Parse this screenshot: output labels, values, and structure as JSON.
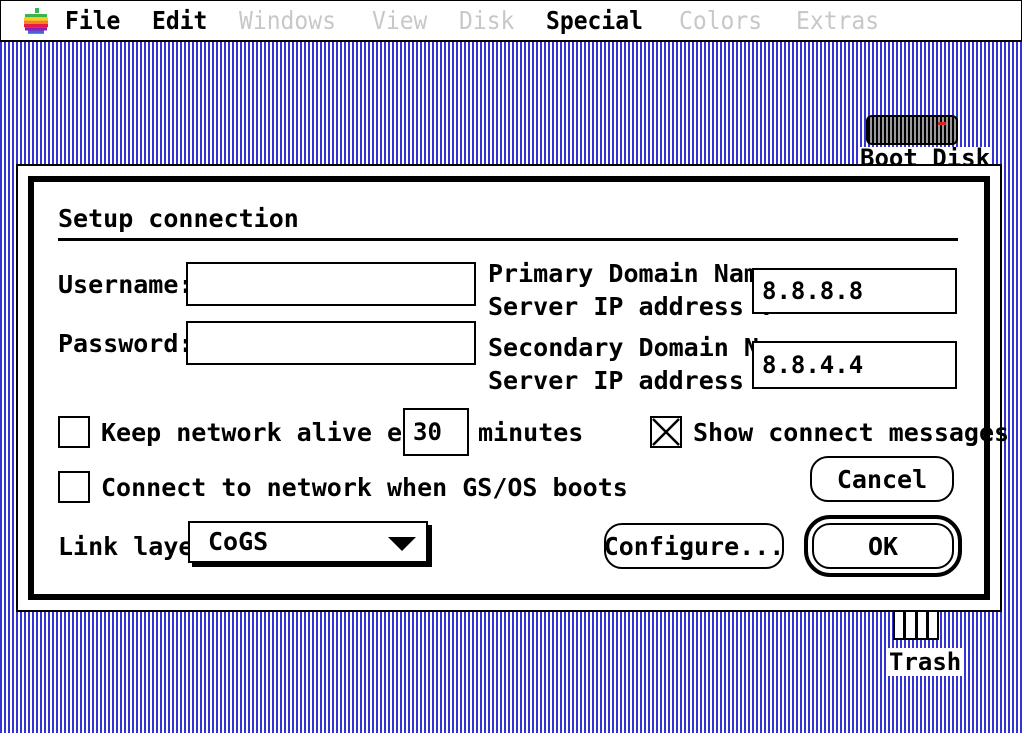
{
  "menubar": {
    "items": [
      {
        "label": "File",
        "enabled": true
      },
      {
        "label": "Edit",
        "enabled": true
      },
      {
        "label": "Windows",
        "enabled": false
      },
      {
        "label": "View",
        "enabled": false
      },
      {
        "label": "Disk",
        "enabled": false
      },
      {
        "label": "Special",
        "enabled": true
      },
      {
        "label": "Colors",
        "enabled": false
      },
      {
        "label": "Extras",
        "enabled": false
      }
    ]
  },
  "desktop": {
    "boot_disk_label": "Boot Disk",
    "trash_label": "Trash"
  },
  "dialog": {
    "title": "Setup connection",
    "username_label": "Username:",
    "username_value": "",
    "password_label": "Password:",
    "password_value": "",
    "primary_dns_label_1": "Primary Domain Name",
    "primary_dns_label_2": "Server IP address :",
    "primary_dns_value": "8.8.8.8",
    "secondary_dns_label_1": "Secondary Domain Name",
    "secondary_dns_label_2": "Server IP address :",
    "secondary_dns_value": "8.8.4.4",
    "keepalive_label": "Keep network alive every",
    "keepalive_checked": false,
    "keepalive_minutes": "30",
    "keepalive_unit": "minutes",
    "show_messages_label": "Show connect messages",
    "show_messages_checked": true,
    "connect_on_boot_label": "Connect to network when GS/OS boots",
    "connect_on_boot_checked": false,
    "link_layer_label": "Link layer:",
    "link_layer_value": "CoGS",
    "cancel_label": "Cancel",
    "configure_label": "Configure...",
    "ok_label": "OK"
  },
  "colors": {
    "desktop": "#3434d4",
    "apple_green": "#3cb44b",
    "apple_yellow": "#f5d020",
    "apple_orange": "#f58220",
    "apple_red": "#e6194b",
    "apple_purple": "#911eb4",
    "apple_blue": "#4363d8"
  }
}
